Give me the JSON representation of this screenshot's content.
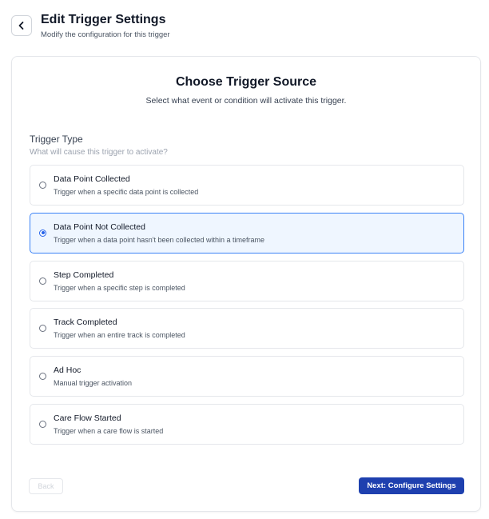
{
  "header": {
    "title": "Edit Trigger Settings",
    "subtitle": "Modify the configuration for this trigger",
    "back_icon": "chevron-left-icon"
  },
  "card": {
    "title": "Choose Trigger Source",
    "subtitle": "Select what event or condition will activate this trigger."
  },
  "trigger_type": {
    "label": "Trigger Type",
    "help": "What will cause this trigger to activate?",
    "selected_index": 1,
    "options": [
      {
        "label": "Data Point Collected",
        "description": "Trigger when a specific data point is collected"
      },
      {
        "label": "Data Point Not Collected",
        "description": "Trigger when a data point hasn't been collected within a timeframe"
      },
      {
        "label": "Step Completed",
        "description": "Trigger when a specific step is completed"
      },
      {
        "label": "Track Completed",
        "description": "Trigger when an entire track is completed"
      },
      {
        "label": "Ad Hoc",
        "description": "Manual trigger activation"
      },
      {
        "label": "Care Flow Started",
        "description": "Trigger when a care flow is started"
      }
    ]
  },
  "footer": {
    "back_label": "Back",
    "next_label": "Next: Configure Settings"
  },
  "colors": {
    "primary": "#1e40af",
    "selected_border": "#3b82f6",
    "selected_bg": "#eff6ff"
  }
}
